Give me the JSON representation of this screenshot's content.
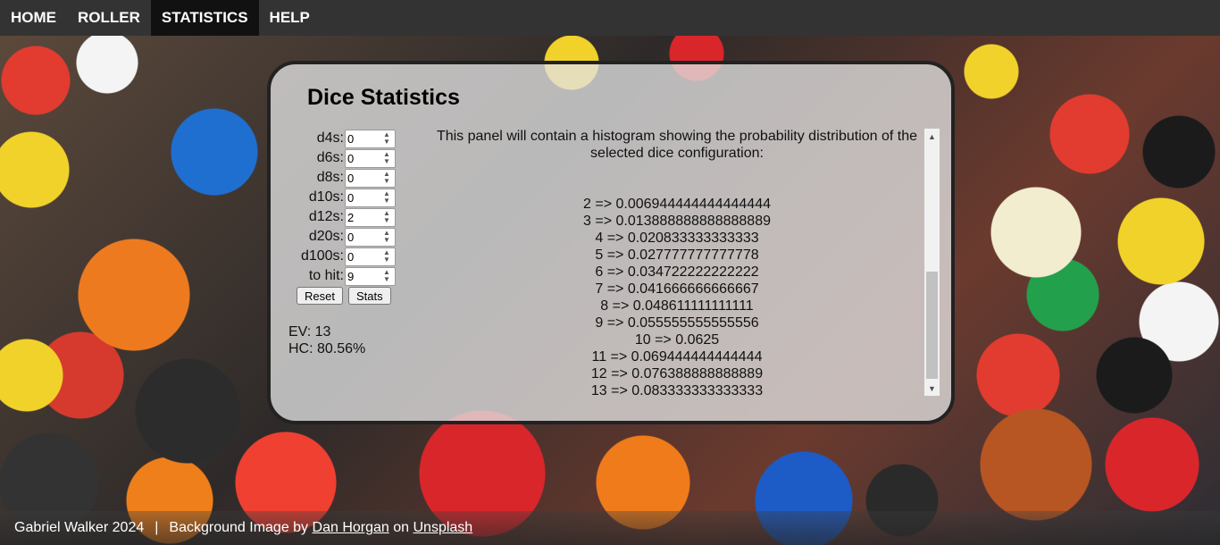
{
  "nav": {
    "items": [
      {
        "label": "HOME"
      },
      {
        "label": "ROLLER"
      },
      {
        "label": "STATISTICS"
      },
      {
        "label": "HELP"
      }
    ],
    "active": "STATISTICS"
  },
  "panel": {
    "title": "Dice Statistics",
    "dice": [
      {
        "label": "d4s:",
        "value": "0"
      },
      {
        "label": "d6s:",
        "value": "0"
      },
      {
        "label": "d8s:",
        "value": "0"
      },
      {
        "label": "d10s:",
        "value": "0"
      },
      {
        "label": "d12s:",
        "value": "2"
      },
      {
        "label": "d20s:",
        "value": "0"
      },
      {
        "label": "d100s:",
        "value": "0"
      },
      {
        "label": "to hit:",
        "value": "9"
      }
    ],
    "reset_label": "Reset",
    "stats_label": "Stats",
    "ev": "EV: 13",
    "hc": "HC: 80.56%",
    "histogram_intro": "This panel will contain a histogram showing the probability distribution of the selected dice configuration:",
    "distribution": [
      "2 => 0.006944444444444444",
      "3 => 0.013888888888888889",
      "4 => 0.020833333333333",
      "5 => 0.027777777777778",
      "6 => 0.034722222222222",
      "7 => 0.041666666666667",
      "8 => 0.048611111111111",
      "9 => 0.055555555555556",
      "10 => 0.0625",
      "11 => 0.069444444444444",
      "12 => 0.076388888888889",
      "13 => 0.083333333333333"
    ]
  },
  "footer": {
    "credit": "Gabriel Walker 2024",
    "separator": "|",
    "bg_prefix": "Background Image by",
    "author": "Dan Horgan",
    "on": "on",
    "site": "Unsplash"
  },
  "colors": {
    "navbar": "#333333",
    "nav_active": "#111111",
    "panel_border": "#222222"
  }
}
